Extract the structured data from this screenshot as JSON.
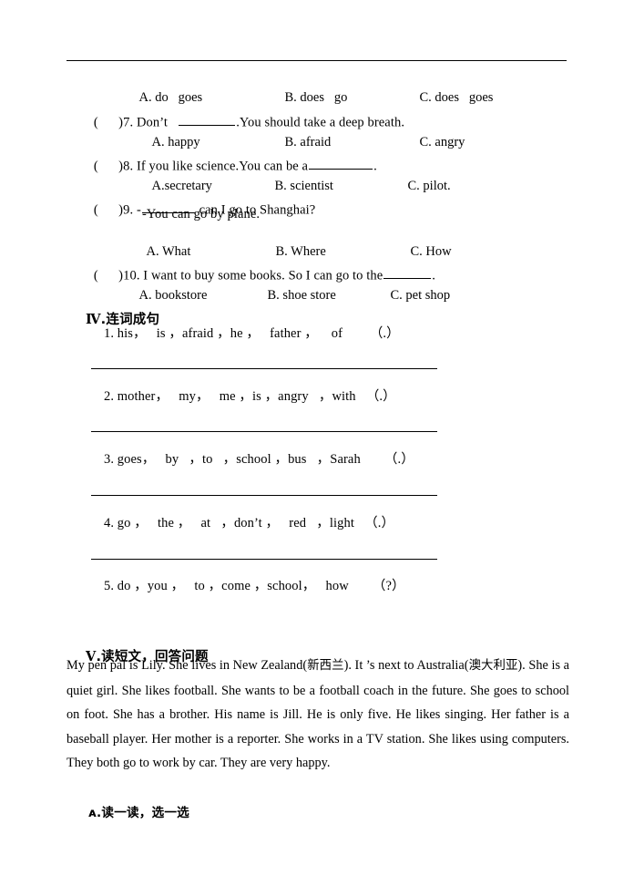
{
  "document": {
    "type": "english-exam-worksheet-page"
  },
  "multiple_choice": {
    "q6_options": {
      "a": "A. do   goes",
      "b": "B. does   go",
      "c": "C. does   goes"
    },
    "items": [
      {
        "bracket": "(      )",
        "number": "7.",
        "stem_before": "Don’t   ",
        "stem_after": ".You should take a deep breath.",
        "options": {
          "a": "A. happy",
          "b": "B. afraid",
          "c": "C. angry"
        }
      },
      {
        "bracket": "(      )",
        "number": "8.",
        "stem_before": "If you like science.You can be a",
        "stem_after": ".",
        "options": {
          "a": "A.secretary",
          "b": "B. scientist",
          "c": "C. pilot."
        }
      },
      {
        "bracket": "(      )",
        "number": "9.",
        "stem_before": "-",
        "stem_after": " can I go to Shanghai?",
        "stem_line2": "-You can go by plane.",
        "options": {
          "a": "A. What",
          "b": "B. Where",
          "c": "C. How"
        }
      },
      {
        "bracket": "(      )",
        "number": "10.",
        "stem_before": "I want to buy some books. So I can go to the",
        "stem_after": ".",
        "options": {
          "a": "A. bookstore",
          "b": "B. shoe store",
          "c": "C. pet shop"
        }
      }
    ]
  },
  "section_iv": {
    "numeral": "Ⅳ",
    "title": ".连词成句",
    "items": [
      "1. his，   is ，afraid ，he ，   father ，    of        （.）",
      "2. mother，   my，   me ，is ，angry   ，with   （.）",
      "3. goes，   by   ，to   ，school ，bus   ，Sarah       （.）",
      "4. go ，   the ，   at   ，don’t ，   red   ，light   （.）",
      "5. do ，you ，   to ，come ，school，   how       （?）"
    ]
  },
  "section_v": {
    "numeral": "Ⅴ",
    "title": ".读短文，回答问题",
    "passage_parts": {
      "p1": "My pen pal is Lily. She lives in New Zealand(",
      "cjk1": "新西兰",
      "p2": "). It ’s next to Australia(",
      "cjk2": "澳大利亚",
      "p3": "). She is a quiet girl. She likes football. She wants to be a football coach in the future. She goes to school on foot. She has a brother. His name is Jill. He is only five. He likes singing. Her father is a baseball player. Her mother is a reporter. She works in a TV station. She likes using computers. They both go to work by car. They are very happy."
    },
    "subsection_a": "ᴀ.读一读，选一选"
  }
}
